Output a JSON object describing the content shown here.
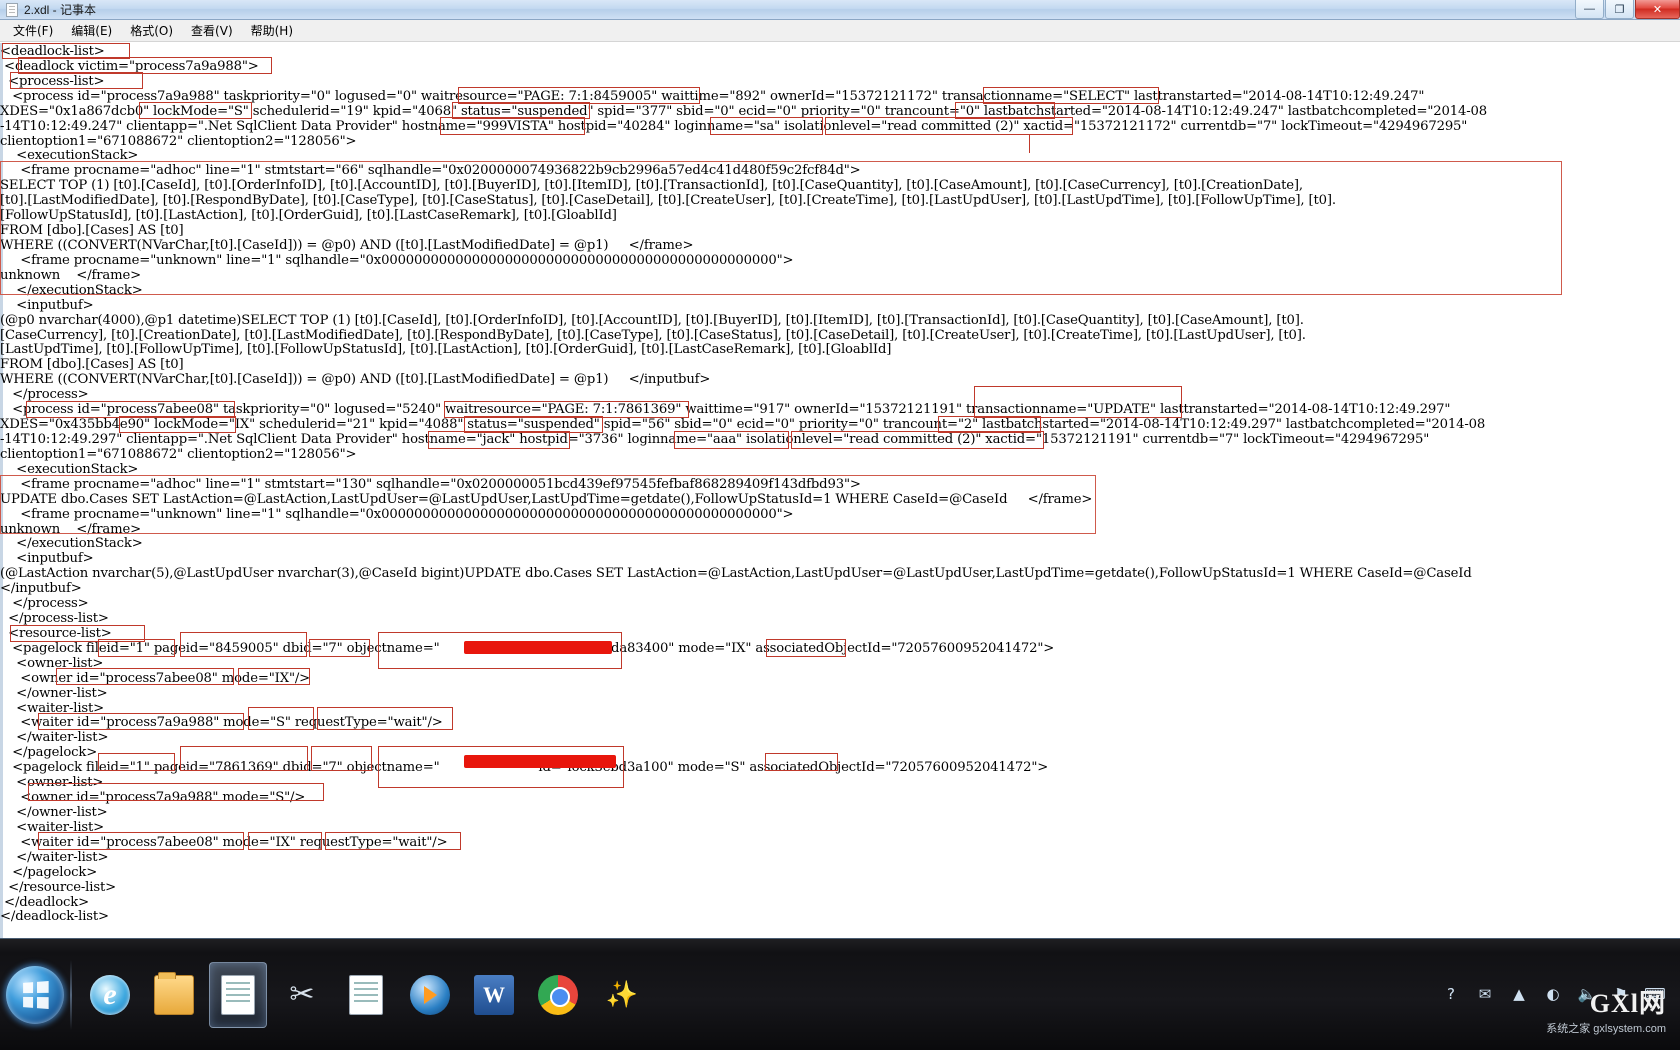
{
  "window": {
    "title": "2.xdl - 记事本",
    "icon": "notepad-icon",
    "buttons": {
      "minimize": "—",
      "maximize": "❐",
      "close": "✕"
    },
    "menu": [
      "文件(F)",
      "编辑(E)",
      "格式(O)",
      "查看(V)",
      "帮助(H)"
    ]
  },
  "document": {
    "filename": "2.xdl",
    "text": "<deadlock-list>\n <deadlock victim=\"process7a9a988\">\n  <process-list>\n   <process id=\"process7a9a988\" taskpriority=\"0\" logused=\"0\" waitresource=\"PAGE: 7:1:8459005\" waittime=\"892\" ownerId=\"15372121172\" transactionname=\"SELECT\" lasttranstarted=\"2014-08-14T10:12:49.247\"\nXDES=\"0x1a867dcb0\" lockMode=\"S\" schedulerid=\"19\" kpid=\"4068\" status=\"suspended\" spid=\"377\" sbid=\"0\" ecid=\"0\" priority=\"0\" trancount=\"0\" lastbatchstarted=\"2014-08-14T10:12:49.247\" lastbatchcompleted=\"2014-08\n-14T10:12:49.247\" clientapp=\".Net SqlClient Data Provider\" hostname=\"999VISTA\" hostpid=\"40284\" loginname=\"sa\" isolationlevel=\"read committed (2)\" xactid=\"15372121172\" currentdb=\"7\" lockTimeout=\"4294967295\"\nclientoption1=\"671088672\" clientoption2=\"128056\">\n    <executionStack>\n     <frame procname=\"adhoc\" line=\"1\" stmtstart=\"66\" sqlhandle=\"0x0200000074936822b9cb2996a57ed4c41d480f59c2fcf84d\">\nSELECT TOP (1) [t0].[CaseId], [t0].[OrderInfoID], [t0].[AccountID], [t0].[BuyerID], [t0].[ItemID], [t0].[TransactionId], [t0].[CaseQuantity], [t0].[CaseAmount], [t0].[CaseCurrency], [t0].[CreationDate],\n[t0].[LastModifiedDate], [t0].[RespondByDate], [t0].[CaseType], [t0].[CaseStatus], [t0].[CaseDetail], [t0].[CreateUser], [t0].[CreateTime], [t0].[LastUpdUser], [t0].[LastUpdTime], [t0].[FollowUpTime], [t0].\n[FollowUpStatusId], [t0].[LastAction], [t0].[OrderGuid], [t0].[LastCaseRemark], [t0].[GloablId]\nFROM [dbo].[Cases] AS [t0]\nWHERE ((CONVERT(NVarChar,[t0].[CaseId])) = @p0) AND ([t0].[LastModifiedDate] = @p1)     </frame>\n     <frame procname=\"unknown\" line=\"1\" sqlhandle=\"0x000000000000000000000000000000000000000000000000\">\nunknown    </frame>\n    </executionStack>\n    <inputbuf>\n(@p0 nvarchar(4000),@p1 datetime)SELECT TOP (1) [t0].[CaseId], [t0].[OrderInfoID], [t0].[AccountID], [t0].[BuyerID], [t0].[ItemID], [t0].[TransactionId], [t0].[CaseQuantity], [t0].[CaseAmount], [t0].\n[CaseCurrency], [t0].[CreationDate], [t0].[LastModifiedDate], [t0].[RespondByDate], [t0].[CaseType], [t0].[CaseStatus], [t0].[CaseDetail], [t0].[CreateUser], [t0].[CreateTime], [t0].[LastUpdUser], [t0].\n[LastUpdTime], [t0].[FollowUpTime], [t0].[FollowUpStatusId], [t0].[LastAction], [t0].[OrderGuid], [t0].[LastCaseRemark], [t0].[GloablId]\nFROM [dbo].[Cases] AS [t0]\nWHERE ((CONVERT(NVarChar,[t0].[CaseId])) = @p0) AND ([t0].[LastModifiedDate] = @p1)     </inputbuf>\n   </process>\n   <process id=\"process7abee08\" taskpriority=\"0\" logused=\"5240\" waitresource=\"PAGE: 7:1:7861369\" waittime=\"917\" ownerId=\"15372121191\" transactionname=\"UPDATE\" lasttranstarted=\"2014-08-14T10:12:49.297\"\nXDES=\"0x435bb4e90\" lockMode=\"IX\" schedulerid=\"21\" kpid=\"4088\" status=\"suspended\" spid=\"56\" sbid=\"0\" ecid=\"0\" priority=\"0\" trancount=\"2\" lastbatchstarted=\"2014-08-14T10:12:49.297\" lastbatchcompleted=\"2014-08\n-14T10:12:49.297\" clientapp=\".Net SqlClient Data Provider\" hostname=\"jack\" hostpid=\"3736\" loginname=\"aaa\" isolationlevel=\"read committed (2)\" xactid=\"15372121191\" currentdb=\"7\" lockTimeout=\"4294967295\"\nclientoption1=\"671088672\" clientoption2=\"128056\">\n    <executionStack>\n     <frame procname=\"adhoc\" line=\"1\" stmtstart=\"130\" sqlhandle=\"0x0200000051bcd439ef97545fefbaf868289409f143dfbd93\">\nUPDATE dbo.Cases SET LastAction=@LastAction,LastUpdUser=@LastUpdUser,LastUpdTime=getdate(),FollowUpStatusId=1 WHERE CaseId=@CaseId     </frame>\n     <frame procname=\"unknown\" line=\"1\" sqlhandle=\"0x000000000000000000000000000000000000000000000000\">\nunknown    </frame>\n    </executionStack>\n    <inputbuf>\n(@LastAction nvarchar(5),@LastUpdUser nvarchar(3),@CaseId bigint)UPDATE dbo.Cases SET LastAction=@LastAction,LastUpdUser=@LastUpdUser,LastUpdTime=getdate(),FollowUpStatusId=1 WHERE CaseId=@CaseId\n</inputbuf>\n   </process>\n  </process-list>\n  <resource-list>\n   <pagelock fileid=\"1\" pageid=\"8459005\" dbid=\"7\" objectname=\"                      \" id=\"lock1bda83400\" mode=\"IX\" associatedObjectId=\"72057600952041472\">\n    <owner-list>\n     <owner id=\"process7abee08\" mode=\"IX\"/>\n    </owner-list>\n    <waiter-list>\n     <waiter id=\"process7a9a988\" mode=\"S\" requestType=\"wait\"/>\n    </waiter-list>\n   </pagelock>\n   <pagelock fileid=\"1\" pageid=\"7861369\" dbid=\"7\" objectname=\"                      \" id=\"lock3ebd3a100\" mode=\"S\" associatedObjectId=\"72057600952041472\">\n    <owner-list>\n     <owner id=\"process7a9a988\" mode=\"S\"/>\n    </owner-list>\n    <waiter-list>\n     <waiter id=\"process7abee08\" mode=\"IX\" requestType=\"wait\"/>\n    </waiter-list>\n   </pagelock>\n  </resource-list>\n </deadlock>\n</deadlock-list>"
  },
  "annotations": {
    "highlight_color": "#c0392b",
    "redaction_color": "#e8160c",
    "highlighted_tokens": [
      "<deadlock-list>",
      "<deadlock victim=\"process7a9a988\">",
      "<process-list>",
      "waitresource=\"PAGE: 7:1:8459005\"",
      "transactionname=\"SELECT\"",
      "lockMode=\"S\"",
      "status=\"suspended\"",
      "hostname=\"999VISTA\"",
      "loginname=\"sa\"",
      "isolationlevel=\"read committed (2)\"",
      "<process id=\"process7abee08\"",
      "waitresource=\"PAGE: 7:1:7861369\"",
      "transactionname=\"UPDATE\"",
      "lockMode=\"IX\"",
      "status=\"suspended\"",
      "hostname=\"jack\"",
      "loginname=\"aaa\"",
      "isolationlevel=\"read committed (2)\"",
      "<resource-list>",
      "fileid=\"1\"",
      "pageid=\"8459005\"",
      "dbid=\"7\"",
      "objectname=\"\"",
      "mode=\"IX\"",
      "owner id=\"process7abee08\" mode=\"IX\"",
      "waiter id=\"process7a9a988\" mode=\"S\" requestType=\"wait\"",
      "pageid=\"7861369\"",
      "mode=\"S\"",
      "owner id=\"process7a9a988\" mode=\"S\"",
      "waiter id=\"process7abee08\" mode=\"IX\" requestType=\"wait\""
    ]
  },
  "taskbar": {
    "start_label": "start-orb",
    "pinned": [
      {
        "name": "internet-explorer",
        "icon": "ie-icon"
      },
      {
        "name": "windows-explorer",
        "icon": "folder-icon"
      },
      {
        "name": "notepad",
        "icon": "notepad-icon"
      },
      {
        "name": "snipping-tool",
        "icon": "scissors-icon"
      },
      {
        "name": "text-document",
        "icon": "document-icon"
      },
      {
        "name": "media-player",
        "icon": "media-player-icon"
      },
      {
        "name": "word",
        "icon": "word-icon"
      },
      {
        "name": "chrome",
        "icon": "chrome-icon"
      },
      {
        "name": "paint",
        "icon": "paint-icon"
      }
    ],
    "tray": [
      "?",
      "chat-icon",
      "arrow-up-icon",
      "network-icon",
      "speaker-icon",
      "flag-icon",
      "keyboard-icon"
    ]
  },
  "watermark": {
    "line1": "GXl网",
    "line2": "系统之家  gxlsystem.com"
  }
}
